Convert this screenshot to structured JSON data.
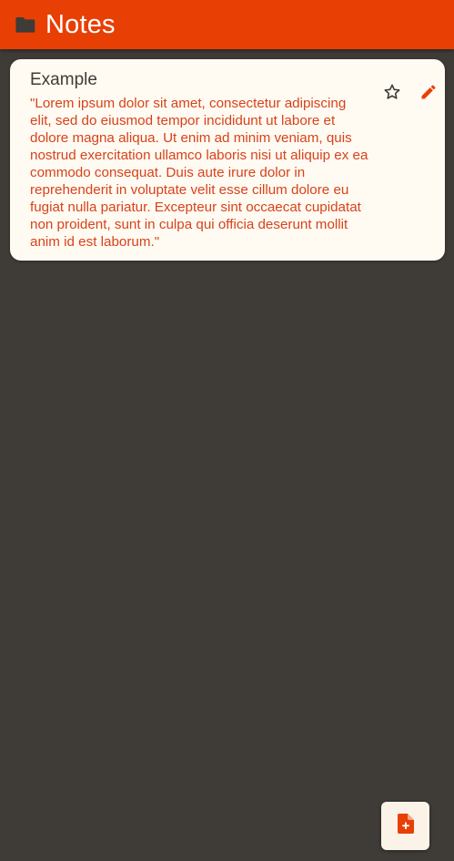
{
  "header": {
    "title": "Notes",
    "icon": "folder-icon"
  },
  "notes": [
    {
      "title": "Example",
      "body": "\"Lorem ipsum dolor sit amet, consectetur adipiscing elit, sed do eiusmod tempor incididunt ut labore et dolore magna aliqua. Ut enim ad minim veniam, quis nostrud exercitation ullamco laboris nisi ut aliquip ex ea commodo consequat. Duis aute irure dolor in reprehenderit in voluptate velit esse cillum dolore eu fugiat nulla pariatur. Excepteur sint occaecat cupidatat non proident, sunt in culpa qui officia deserunt mollit anim id est laborum.\"",
      "star_icon": "star-outline-icon",
      "edit_icon": "pencil-icon"
    }
  ],
  "fab": {
    "icon": "add-note-icon"
  },
  "colors": {
    "accent": "#e83f05",
    "background": "#3f3c38",
    "card": "#fffbf2",
    "note_text": "#d8421b"
  }
}
